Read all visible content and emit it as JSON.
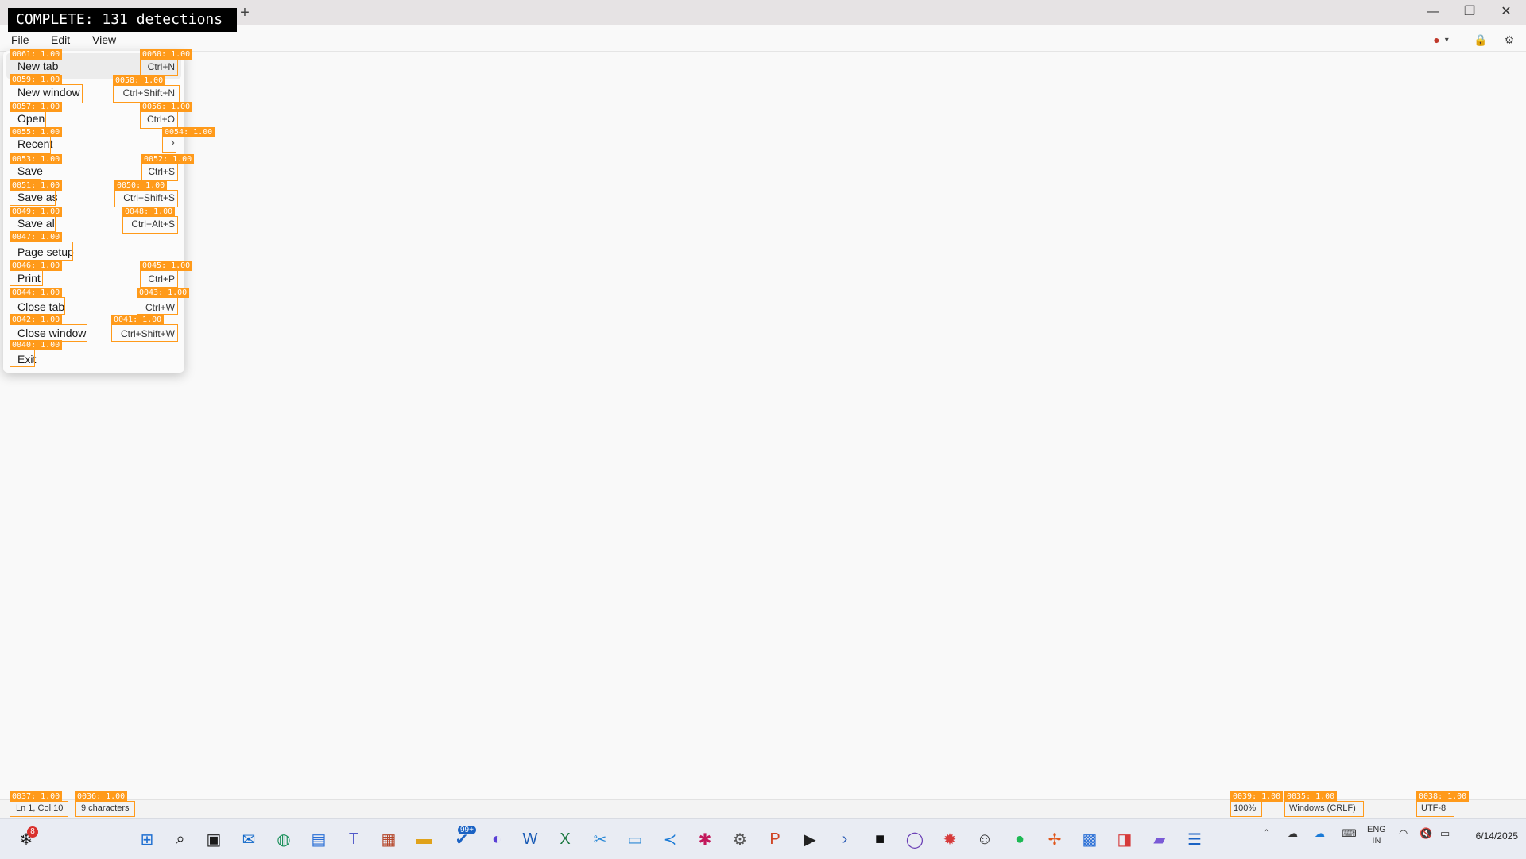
{
  "overlay": {
    "status": "COMPLETE: 131 detections"
  },
  "titlebar": {
    "new_tab": "+",
    "minimize": "—",
    "restore": "❐",
    "close": "✕"
  },
  "menubar": {
    "file": "File",
    "edit": "Edit",
    "view": "View"
  },
  "file_menu": {
    "items": [
      {
        "label": "New tab",
        "shortcut": "Ctrl+N"
      },
      {
        "label": "New window",
        "shortcut": "Ctrl+Shift+N"
      },
      {
        "label": "Open",
        "shortcut": "Ctrl+O"
      },
      {
        "label": "Recent",
        "shortcut": ""
      },
      {
        "label": "Save",
        "shortcut": "Ctrl+S"
      },
      {
        "label": "Save as",
        "shortcut": "Ctrl+Shift+S"
      },
      {
        "label": "Save all",
        "shortcut": "Ctrl+Alt+S"
      },
      {
        "label": "Page setup",
        "shortcut": ""
      },
      {
        "label": "Print",
        "shortcut": "Ctrl+P"
      },
      {
        "label": "Close tab",
        "shortcut": "Ctrl+W"
      },
      {
        "label": "Close window",
        "shortcut": "Ctrl+Shift+W"
      },
      {
        "label": "Exit",
        "shortcut": ""
      }
    ],
    "submenu_chevron": "›"
  },
  "statusbar": {
    "position": "Ln 1, Col 10",
    "characters": "9 characters",
    "zoom": "100%",
    "line_ending": "Windows (CRLF)",
    "encoding": "UTF-8"
  },
  "taskbar": {
    "notification_count": "8",
    "mail_badge": "99+",
    "language_top": "ENG",
    "language_bottom": "IN",
    "date": "6/14/2025",
    "apps": [
      "start-icon",
      "search-icon",
      "file-explorer-icon",
      "outlook-icon",
      "edge-icon",
      "store-icon",
      "teams-icon",
      "calendar-icon",
      "folder-icon",
      "mail-icon",
      "copilot-icon",
      "word-icon",
      "excel-icon",
      "snipping-icon",
      "photos-icon",
      "vscode-icon",
      "slack-icon",
      "settings-icon",
      "powerpoint-icon",
      "terminal-icon",
      "powershell-icon",
      "app-icon",
      "github-icon",
      "chrome-icon",
      "notepad-icon",
      "spotify-icon",
      "pinwheel-icon",
      "remote-icon",
      "viewer-icon",
      "files-icon",
      "notepad-active-icon"
    ]
  },
  "detections": [
    {
      "label": "0061: 1.00"
    },
    {
      "label": "0060: 1.00"
    },
    {
      "label": "0059: 1.00"
    },
    {
      "label": "0058: 1.00"
    },
    {
      "label": "0057: 1.00"
    },
    {
      "label": "0056: 1.00"
    },
    {
      "label": "0055: 1.00"
    },
    {
      "label": "0054: 1.00"
    },
    {
      "label": "0053: 1.00"
    },
    {
      "label": "0052: 1.00"
    },
    {
      "label": "0051: 1.00"
    },
    {
      "label": "0050: 1.00"
    },
    {
      "label": "0049: 1.00"
    },
    {
      "label": "0048: 1.00"
    },
    {
      "label": "0047: 1.00"
    },
    {
      "label": "0046: 1.00"
    },
    {
      "label": "0045: 1.00"
    },
    {
      "label": "0044: 1.00"
    },
    {
      "label": "0043: 1.00"
    },
    {
      "label": "0042: 1.00"
    },
    {
      "label": "0041: 1.00"
    },
    {
      "label": "0040: 1.00"
    },
    {
      "label": "0037: 1.00"
    },
    {
      "label": "0036: 1.00"
    },
    {
      "label": "0039: 1.00"
    },
    {
      "label": "0035: 1.00"
    },
    {
      "label": "0038: 1.00"
    }
  ]
}
